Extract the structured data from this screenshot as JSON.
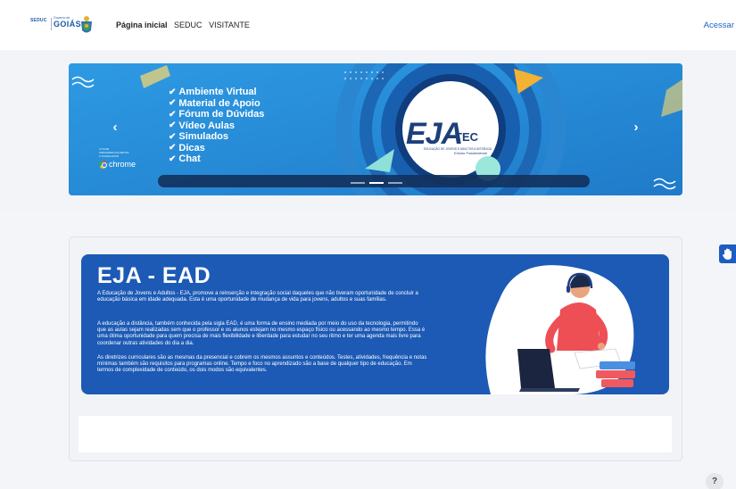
{
  "header": {
    "logo_seduc": "SEDUC",
    "logo_gov": "Governo de",
    "logo_goias": "GOIÁS",
    "nav": [
      "Página inicial",
      "SEDUC",
      "VISITANTE"
    ],
    "login": "Acessar"
  },
  "carousel": {
    "features": [
      "Ambiente Virtual",
      "Material de Apoio",
      "Fórum de Dúvidas",
      "Vídeo Aulas",
      "Simulados",
      "Dicas",
      "Chat"
    ],
    "chrome_hint": "UTILIZE PREFERENCIALMENTE O NAVEGADOR",
    "chrome_label": "chrome",
    "logo_main": "EJA",
    "logo_suffix": "TEC",
    "logo_subtitle": "EDUCAÇÃO DE JOVENS E ADULTOS A DISTÂNCIA",
    "logo_tagline": "Ensino Fundamental",
    "prev_icon": "chevron-left-icon",
    "next_icon": "chevron-right-icon",
    "active_slide": 2,
    "slide_count": 3
  },
  "banner": {
    "title": "EJA - EAD",
    "paragraphs": [
      "A Educação de Jovens e Adultos - EJA, promove a reinserção e integração social daqueles que não tiveram oportunidade de concluir a educação básica em idade adequada. Esta é uma oportunidade de mudança de vida para jovens, adultos e suas famílias.",
      "A educação a distância, também conhecida pela sigla EAD, é uma forma de ensino mediada por meio do uso da tecnologia, permitindo que as aulas sejam realizadas sem que o professor e os alunos estejam no mesmo espaço físico ou acessando ao mesmo tempo. Essa é uma ótima oportunidade para quem precisa de mais flexibilidade e liberdade para estudar no seu ritmo e ter uma agenda mais livre para coordenar outras atividades do dia a dia.",
      "As diretrizes curriculares são as mesmas da presencial e cobrem os mesmos assuntos e conteúdos. Testes, atividades, frequência e notas mínimas também são requisitos para programas online. Tempo e foco no aprendizado são a base de qualquer tipo de educação. Em termos de complexidade de conteúdo, os dois modos são equivalentes."
    ]
  },
  "floating": {
    "accessibility_icon": "hand-sign-icon",
    "help_label": "?"
  },
  "colors": {
    "primary": "#1c5ab5",
    "carousel_bg": "#2a91dd",
    "link": "#1b66c8"
  }
}
